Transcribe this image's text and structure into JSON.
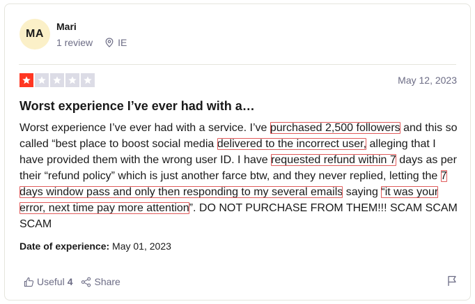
{
  "reviewer": {
    "initials": "MA",
    "name": "Mari",
    "review_count": "1 review",
    "country": "IE"
  },
  "review": {
    "rating": 1,
    "max_rating": 5,
    "date": "May 12, 2023",
    "title": "Worst experience I’ve ever had with a…",
    "body_segments": [
      {
        "text": "Worst experience I’ve ever had with a service. I’ve ",
        "highlight": false
      },
      {
        "text": "purchased 2,500 followers",
        "highlight": true
      },
      {
        "text": " and this so called “best place to boost social media ",
        "highlight": false
      },
      {
        "text": "delivered to the incorrect user,",
        "highlight": true
      },
      {
        "text": " alleging that I have provided them with the wrong user ID. I have ",
        "highlight": false
      },
      {
        "text": "requested refund within 7",
        "highlight": true
      },
      {
        "text": " days as per their “refund policy” which is just another farce btw, and they never replied, letting the ",
        "highlight": false
      },
      {
        "text": "7 days window pass and only then responding to my several emails",
        "highlight": true
      },
      {
        "text": " saying ",
        "highlight": false
      },
      {
        "text": "“it was your error, next time pay more attention",
        "highlight": true
      },
      {
        "text": "”. DO NOT PURCHASE FROM THEM!!! SCAM SCAM SCAM",
        "highlight": false
      }
    ],
    "experience_label": "Date of experience:",
    "experience_date": " May 01, 2023"
  },
  "actions": {
    "useful_label": "Useful",
    "useful_count": "4",
    "share_label": "Share"
  },
  "colors": {
    "star_filled": "#ff3722",
    "star_empty": "#dcdce6",
    "highlight_box": "#e05a5a",
    "avatar_bg": "#fbf0c8"
  },
  "icons": [
    "location-pin-icon",
    "star-icon",
    "thumbs-up-icon",
    "share-icon",
    "flag-icon"
  ]
}
